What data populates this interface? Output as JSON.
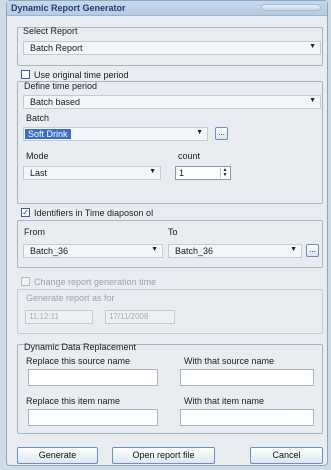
{
  "window": {
    "title": "Dynamic Report Generator"
  },
  "select_report": {
    "label": "Select Report",
    "value": "Batch Report"
  },
  "use_original": {
    "label": "Use original time period",
    "checked": false
  },
  "define_time": {
    "label": "Define time period",
    "mode_value": "Batch based",
    "batch_label": "Batch",
    "batch_value": "Soft Drink",
    "mode_label": "Mode",
    "mode_select": "Last",
    "count_label": "count",
    "count_value": "1"
  },
  "identifiers": {
    "label": "Identifiers in Time diaposon ol",
    "checked": true,
    "from_label": "From",
    "from_value": "Batch_36",
    "to_label": "To",
    "to_value": "Batch_36"
  },
  "change_time": {
    "label": "Change report generation time",
    "generate_as_for": "Generate report as for",
    "time_value": "11:12:11",
    "date_value": "17/11/2008"
  },
  "dynamic": {
    "title": "Dynamic Data Replacement",
    "replace_source": "Replace this source name",
    "with_source": "With that source name",
    "replace_item": "Replace this item name",
    "with_item": "With that item name"
  },
  "buttons": {
    "generate": "Generate",
    "open_report": "Open report file",
    "cancel": "Cancel"
  },
  "glyphs": {
    "ellipsis": "...",
    "check": "✓",
    "arrow": "▼",
    "up": "▲",
    "down": "▼"
  }
}
